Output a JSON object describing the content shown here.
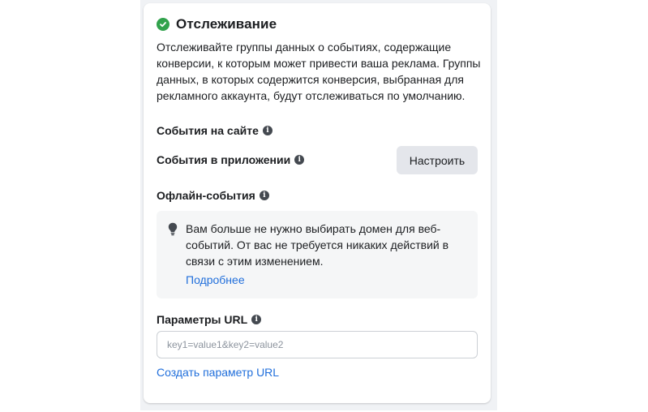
{
  "tracking": {
    "title": "Отслеживание",
    "description": "Отслеживайте группы данных о событиях, содержащие конверсии, к которым может привести ваша реклама. Группы данных, в которых содержится конверсия, выбранная для рекламного аккаунта, будут отслеживаться по умолчанию."
  },
  "sections": {
    "website_events": "События на сайте",
    "app_events": "События в приложении",
    "offline_events": "Офлайн-события",
    "url_params": "Параметры URL"
  },
  "buttons": {
    "setup": "Настроить"
  },
  "notice": {
    "text": "Вам больше не нужно выбирать домен для веб-событий. От вас не требуется никаких действий в связи с этим изменением.",
    "link": "Подробнее"
  },
  "url_input": {
    "placeholder": "key1=value1&key2=value2",
    "value": ""
  },
  "create_url_link": "Создать параметр URL",
  "icons": {
    "status": "check-circle-icon",
    "info": "info-icon",
    "notice": "lightbulb-icon"
  },
  "colors": {
    "success": "#31a24c",
    "link": "#216fdb",
    "button_bg": "#e4e6eb"
  }
}
